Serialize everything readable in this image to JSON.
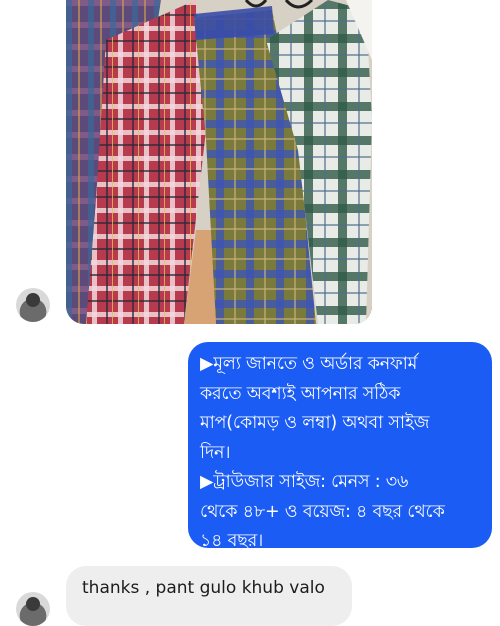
{
  "conversation": {
    "photo": {
      "description_icon": "checkered-trousers-photo"
    },
    "outgoing_message": {
      "lines": [
        "▶মূল্য জানতে ও অর্ডার কনফার্ম",
        "করতে অবশ্যই আপনার  সঠিক",
        "মাপ(কোমড় ও লম্বা) অথবা সাইজ",
        "দিন।",
        "▶ট্রাউজার সাইজ: মেনস : ৩৬",
        "থেকে ৪৮+ ও বয়েজ: ৪ বছর থেকে",
        "১৪ বছর।"
      ],
      "bubble_color": "#1a5cf4"
    },
    "incoming_message": {
      "text": "thanks , pant gulo khub valo",
      "bubble_color": "#eeeeee"
    }
  }
}
